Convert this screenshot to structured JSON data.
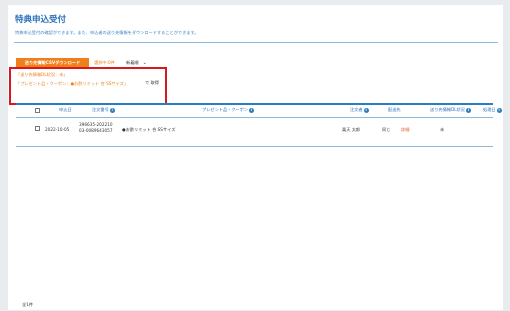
{
  "page": {
    "title": "特典申込受付",
    "description": "特典申込受付の確認ができます。また、申込者の送り先情報をダウンロードすることができます。"
  },
  "toolbar": {
    "csv_button": "送り先情報CSVダウンロード",
    "count_text": "選択中:0件",
    "sort_label": "新着順"
  },
  "filter": {
    "conditions": [
      "「送り先情報DL状況：未」",
      "「プレゼント品・クーポン：●お酢リミット 合 SSサイズ」"
    ],
    "suffix": "で 取得"
  },
  "table": {
    "headers": {
      "date": "申込日",
      "order": "注文番号",
      "gift": "プレゼント品・クーポン",
      "orderer": "注文者",
      "shipto": "配送先",
      "dlstatus": "送り先情報DL状況",
      "processed": "処理日"
    },
    "rows": [
      {
        "date": "2022-10-05",
        "order_line1": "396635-202210",
        "order_line2": "03-0089643057",
        "gift": "●お酢リミット 合 SSサイズ",
        "orderer": "楽天 太郎",
        "shipto": "同じ",
        "detail_link": "詳細",
        "dlstatus": "未",
        "processed": ""
      }
    ]
  },
  "footer": {
    "total": "全1件"
  }
}
